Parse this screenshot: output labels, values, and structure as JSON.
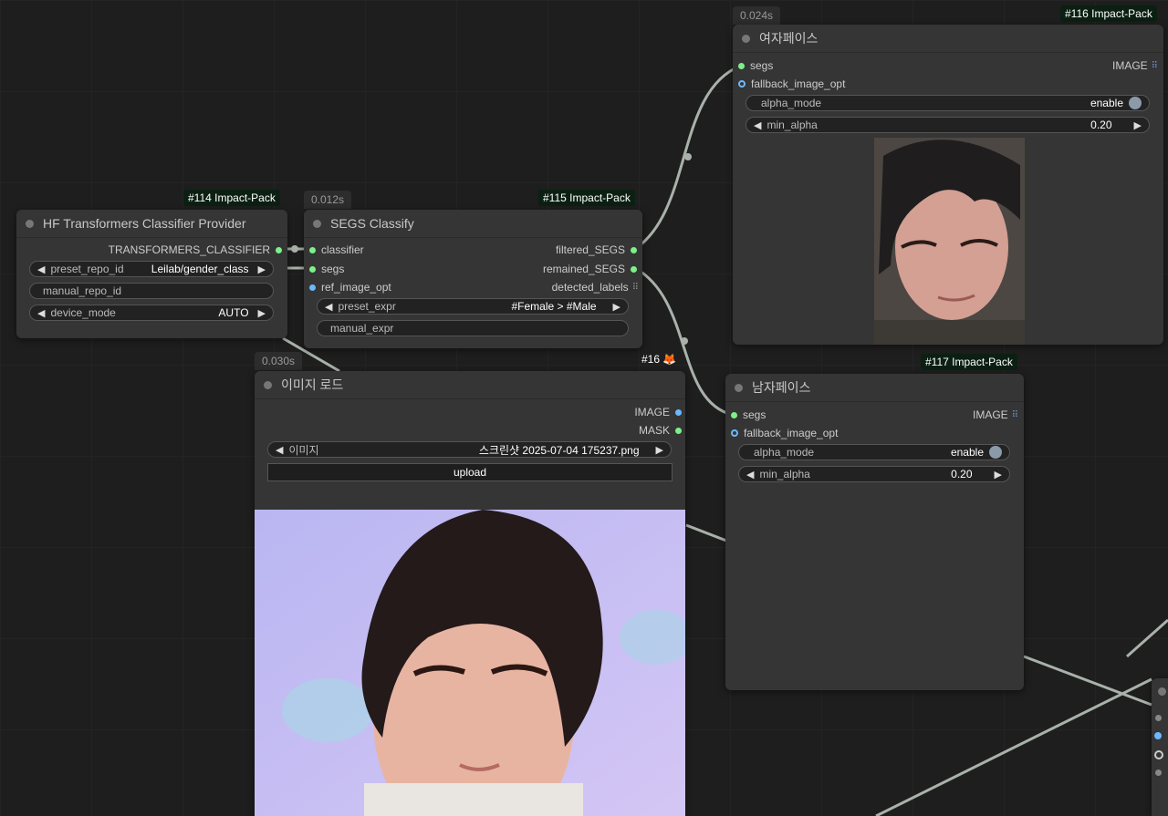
{
  "nodes": {
    "hf": {
      "badge": "#114 Impact-Pack",
      "title": "HF Transformers Classifier Provider",
      "output": "TRANSFORMERS_CLASSIFIER",
      "preset_label": "preset_repo_id",
      "preset_value": "Leilab/gender_class",
      "manual_label": "manual_repo_id",
      "device_label": "device_mode",
      "device_value": "AUTO"
    },
    "segs": {
      "timing": "0.012s",
      "badge": "#115 Impact-Pack",
      "title": "SEGS Classify",
      "in_classifier": "classifier",
      "in_segs": "segs",
      "in_ref": "ref_image_opt",
      "out_filtered": "filtered_SEGS",
      "out_remained": "remained_SEGS",
      "out_labels": "detected_labels",
      "preset_label": "preset_expr",
      "preset_value": "#Female > #Male",
      "manual_label": "manual_expr"
    },
    "female": {
      "timing": "0.024s",
      "badge": "#116 Impact-Pack",
      "title": "여자페이스",
      "in_segs": "segs",
      "in_fallback": "fallback_image_opt",
      "out_image": "IMAGE",
      "alpha_label": "alpha_mode",
      "alpha_value": "enable",
      "min_label": "min_alpha",
      "min_value": "0.20"
    },
    "male": {
      "badge": "#117 Impact-Pack",
      "title": "남자페이스",
      "in_segs": "segs",
      "in_fallback": "fallback_image_opt",
      "out_image": "IMAGE",
      "alpha_label": "alpha_mode",
      "alpha_value": "enable",
      "min_label": "min_alpha",
      "min_value": "0.20"
    },
    "load": {
      "timing": "0.030s",
      "badge": "#16 🦊",
      "title": "이미지 로드",
      "out_image": "IMAGE",
      "out_mask": "MASK",
      "image_label": "이미지",
      "image_value": "스크린샷 2025-07-04 175237.png",
      "upload_label": "upload"
    }
  },
  "colors": {
    "canvas": "#1e1e1e",
    "node_bg": "#353535",
    "badge_bg": "#0b2012",
    "socket_green": "#7df089",
    "socket_blue": "#6bb8ff",
    "link": "#a9b2aa"
  }
}
